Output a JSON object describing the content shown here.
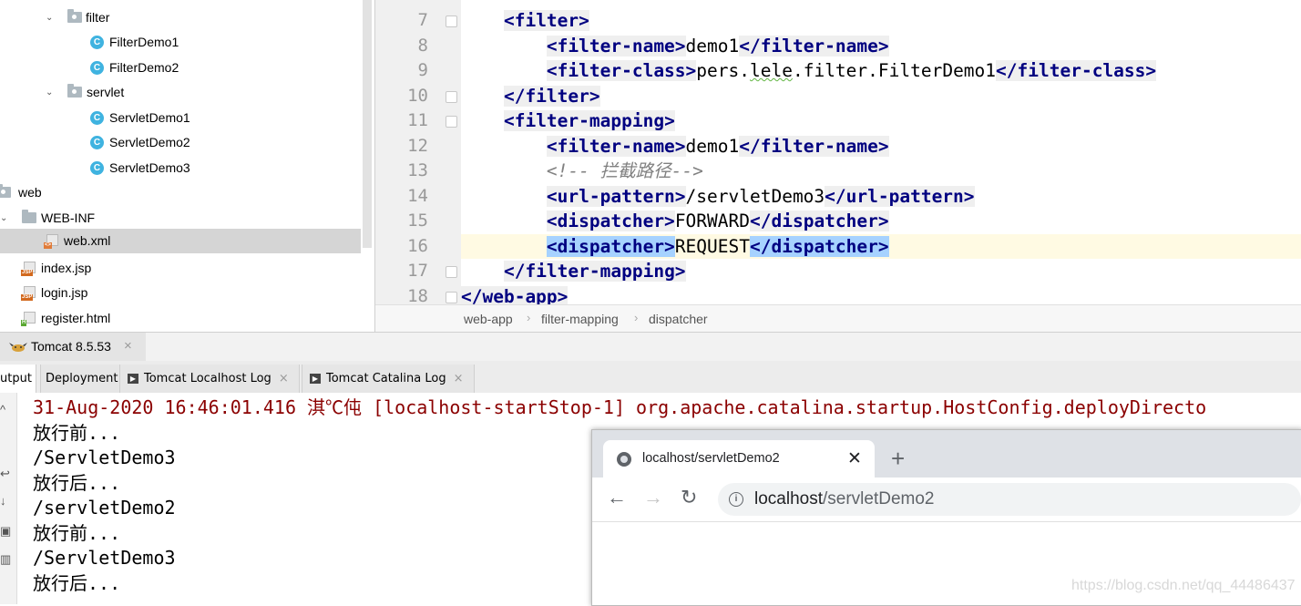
{
  "project_tree": {
    "items": [
      {
        "label": "filter",
        "kind": "package"
      },
      {
        "label": "FilterDemo1",
        "kind": "class",
        "icon_letter": "C"
      },
      {
        "label": "FilterDemo2",
        "kind": "class",
        "icon_letter": "C"
      },
      {
        "label": "servlet",
        "kind": "package"
      },
      {
        "label": "ServletDemo1",
        "kind": "class",
        "icon_letter": "C"
      },
      {
        "label": "ServletDemo2",
        "kind": "class",
        "icon_letter": "C"
      },
      {
        "label": "ServletDemo3",
        "kind": "class",
        "icon_letter": "C"
      },
      {
        "label": "web",
        "kind": "folder"
      },
      {
        "label": "WEB-INF",
        "kind": "folder"
      },
      {
        "label": "web.xml",
        "kind": "xml",
        "selected": true
      },
      {
        "label": "index.jsp",
        "kind": "jsp",
        "badge": "JSP"
      },
      {
        "label": "login.jsp",
        "kind": "jsp",
        "badge": "JSP"
      },
      {
        "label": "register.html",
        "kind": "html",
        "badge": "H"
      }
    ]
  },
  "editor": {
    "lines": [
      {
        "num": "7",
        "indent": "    ",
        "segments": [
          {
            "t": "tag",
            "v": "<filter>"
          }
        ]
      },
      {
        "num": "8",
        "indent": "        ",
        "segments": [
          {
            "t": "tag",
            "v": "<filter-name>"
          },
          {
            "t": "text",
            "v": "demo1"
          },
          {
            "t": "tag",
            "v": "</filter-name>"
          }
        ]
      },
      {
        "num": "9",
        "indent": "        ",
        "segments": [
          {
            "t": "tag",
            "v": "<filter-class>"
          },
          {
            "t": "text",
            "v": "pers."
          },
          {
            "t": "squig",
            "v": "lele"
          },
          {
            "t": "text",
            "v": ".filter.FilterDemo1"
          },
          {
            "t": "tag",
            "v": "</filter-class>"
          }
        ]
      },
      {
        "num": "10",
        "indent": "    ",
        "segments": [
          {
            "t": "tag",
            "v": "</filter>"
          }
        ]
      },
      {
        "num": "11",
        "indent": "    ",
        "segments": [
          {
            "t": "tag",
            "v": "<filter-mapping>"
          }
        ]
      },
      {
        "num": "12",
        "indent": "        ",
        "segments": [
          {
            "t": "tag",
            "v": "<filter-name>"
          },
          {
            "t": "text",
            "v": "demo1"
          },
          {
            "t": "tag",
            "v": "</filter-name>"
          }
        ]
      },
      {
        "num": "13",
        "indent": "        ",
        "segments": [
          {
            "t": "comment",
            "v": "<!-- 拦截路径-->"
          }
        ]
      },
      {
        "num": "14",
        "indent": "        ",
        "segments": [
          {
            "t": "tag",
            "v": "<url-pattern>"
          },
          {
            "t": "text",
            "v": "/servletDemo3"
          },
          {
            "t": "tag",
            "v": "</url-pattern>"
          }
        ]
      },
      {
        "num": "15",
        "indent": "        ",
        "segments": [
          {
            "t": "tag",
            "v": "<dispatcher>"
          },
          {
            "t": "text",
            "v": "FORWARD"
          },
          {
            "t": "tag",
            "v": "</dispatcher>"
          }
        ]
      },
      {
        "num": "16",
        "indent": "        ",
        "current": true,
        "segments": [
          {
            "t": "taghl",
            "v": "<dispatcher>"
          },
          {
            "t": "text",
            "v": "REQUEST"
          },
          {
            "t": "taghl",
            "v": "</dispatcher>"
          }
        ]
      },
      {
        "num": "17",
        "indent": "    ",
        "segments": [
          {
            "t": "tag",
            "v": "</filter-mapping>"
          }
        ]
      },
      {
        "num": "18",
        "indent": "",
        "segments": [
          {
            "t": "tag",
            "v": "</web-app>"
          }
        ]
      }
    ],
    "breadcrumb": [
      "web-app",
      "filter-mapping",
      "dispatcher"
    ],
    "breadcrumb_sep": "›"
  },
  "run_panel": {
    "tab_title": "Tomcat 8.5.53",
    "close_glyph": "×",
    "subtabs": [
      {
        "label": "utput",
        "active": true,
        "has_icon": false,
        "closable": false
      },
      {
        "label": "Deployment",
        "active": false,
        "has_icon": false,
        "closable": false
      },
      {
        "label": "Tomcat Localhost Log",
        "active": false,
        "has_icon": true,
        "closable": true
      },
      {
        "label": "Tomcat Catalina Log",
        "active": false,
        "has_icon": true,
        "closable": true
      }
    ]
  },
  "console": {
    "lines": [
      {
        "text": "31-Aug-2020 16:46:01.416 淇℃伅 [localhost-startStop-1] org.apache.catalina.startup.HostConfig.deployDirecto",
        "color": "red"
      },
      {
        "text": "放行前...",
        "color": "black"
      },
      {
        "text": "/ServletDemo3",
        "color": "black"
      },
      {
        "text": "放行后...",
        "color": "black"
      },
      {
        "text": "/servletDemo2",
        "color": "black"
      },
      {
        "text": "放行前...",
        "color": "black"
      },
      {
        "text": "/ServletDemo3",
        "color": "black"
      },
      {
        "text": "放行后...",
        "color": "black"
      }
    ]
  },
  "browser": {
    "tab_title": "localhost/servletDemo2",
    "tab_close": "✕",
    "new_tab": "+",
    "back": "←",
    "forward": "→",
    "reload": "↻",
    "info_glyph": "i",
    "url_host": "localhost",
    "url_path": "/servletDemo2"
  },
  "watermark": "https://blog.csdn.net/qq_44486437",
  "colors": {
    "tag": "#000080",
    "comment": "#808080",
    "console_red": "#8b0000",
    "current_line": "#fffae3",
    "tag_highlight": "#a6d2ff",
    "class_icon": "#3fb3e0"
  }
}
